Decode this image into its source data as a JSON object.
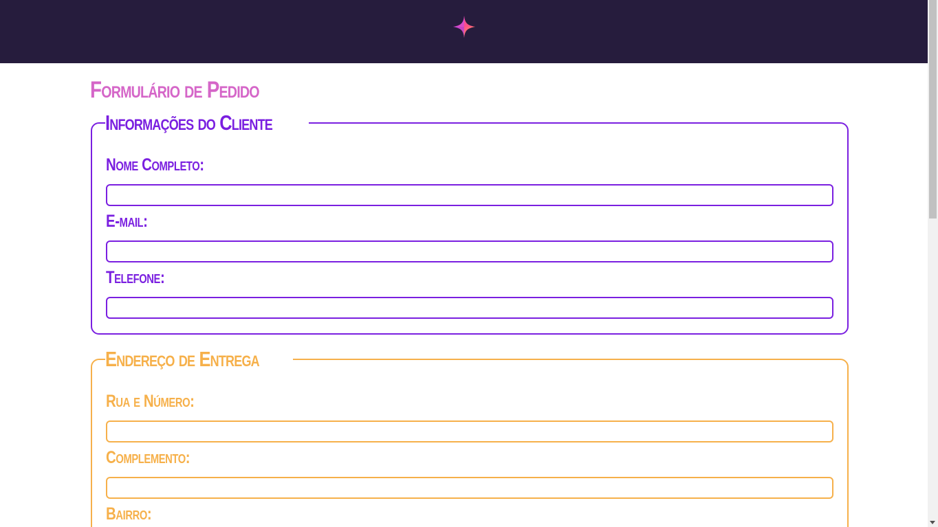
{
  "header": {
    "logo_icon": "sparkle-star-icon",
    "background_color": "#261c3d"
  },
  "page": {
    "title": "Formulário de Pedido",
    "title_color": "#d566c8"
  },
  "client_section": {
    "legend": "Informações do Cliente",
    "color": "#7a1fe0",
    "fields": {
      "full_name": {
        "label": "Nome Completo:",
        "value": ""
      },
      "email": {
        "label": "E-mail:",
        "value": ""
      },
      "phone": {
        "label": "Telefone:",
        "value": ""
      }
    }
  },
  "address_section": {
    "legend": "Endereço de Entrega",
    "color": "#f6b04a",
    "fields": {
      "street": {
        "label": "Rua e Número:",
        "value": ""
      },
      "complement": {
        "label": "Complemento:",
        "value": ""
      },
      "neighborhood": {
        "label": "Bairro:"
      }
    }
  }
}
